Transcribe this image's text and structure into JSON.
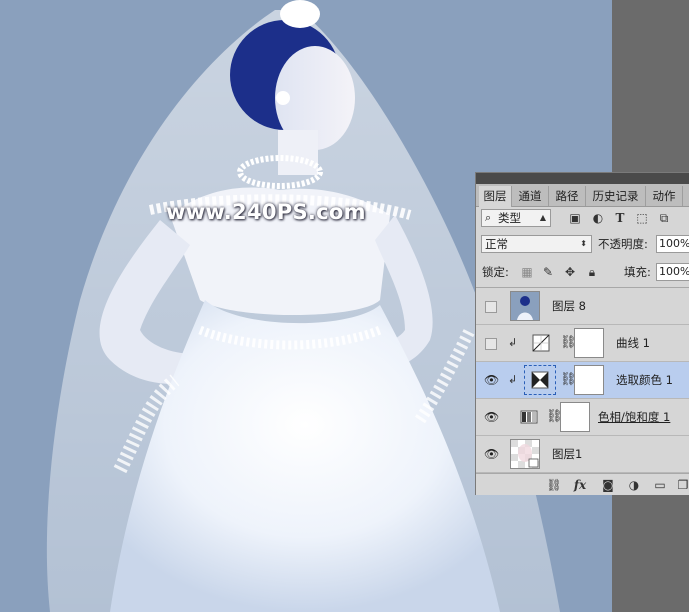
{
  "watermark": "www.240PS.com",
  "colors": {
    "canvas_bg": "#8aa0bd",
    "pasteboard": "#6b6b6b",
    "panel_bg": "#d6d6d6",
    "selected_row": "#b9cdee"
  },
  "layers_panel": {
    "tabs": [
      {
        "label": "图层",
        "active": true
      },
      {
        "label": "通道",
        "active": false
      },
      {
        "label": "路径",
        "active": false
      },
      {
        "label": "历史记录",
        "active": false
      },
      {
        "label": "动作",
        "active": false
      }
    ],
    "filter": {
      "icon": "search-icon",
      "label": "类型"
    },
    "filter_icons": [
      "image-filter-icon",
      "adjustment-filter-icon",
      "type-filter-icon",
      "shape-filter-icon",
      "smart-object-filter-icon"
    ],
    "blend_mode": "正常",
    "opacity_label": "不透明度:",
    "opacity_value": "100%",
    "lock_label": "锁定:",
    "lock_icons": [
      "lock-transparent-icon",
      "lock-image-icon",
      "lock-position-icon",
      "lock-all-icon"
    ],
    "fill_label": "填充:",
    "fill_value": "100%",
    "layers": [
      {
        "name": "图层 8",
        "visible": false,
        "selected": false,
        "type": "pixel",
        "clipped": false
      },
      {
        "name": "曲线 1",
        "visible": false,
        "selected": false,
        "type": "curves",
        "clipped": true
      },
      {
        "name": "选取颜色 1",
        "visible": true,
        "selected": true,
        "type": "selective-color",
        "clipped": true
      },
      {
        "name": "色相/饱和度 1",
        "visible": true,
        "selected": false,
        "type": "hue-saturation",
        "clipped": false
      },
      {
        "name": "图层1",
        "visible": true,
        "selected": false,
        "type": "smart-object",
        "clipped": false
      }
    ],
    "footer_icons": [
      "link-layers-icon",
      "fx-icon",
      "add-mask-icon",
      "new-adjustment-icon",
      "new-group-icon",
      "new-layer-icon"
    ]
  }
}
